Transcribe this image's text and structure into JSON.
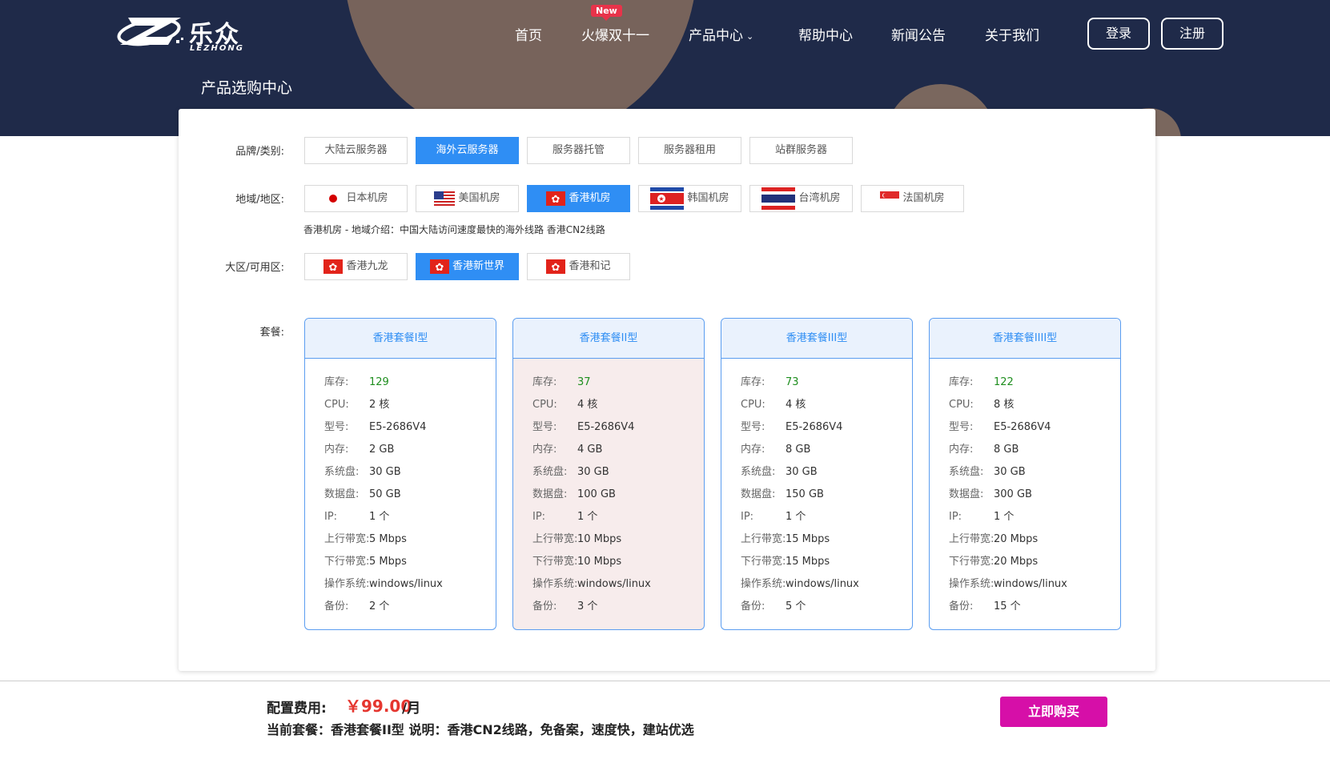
{
  "logo": {
    "cn": "乐众",
    "en": "LEZHONG"
  },
  "nav": {
    "items": [
      "首页",
      "火爆双十一",
      "产品中心",
      "帮助中心",
      "新闻公告",
      "关于我们"
    ],
    "badge": "New",
    "login": "登录",
    "register": "注册"
  },
  "page_title": "产品选购中心",
  "filters": {
    "brand_label": "品牌/类别:",
    "brands": [
      "大陆云服务器",
      "海外云服务器",
      "服务器托管",
      "服务器租用",
      "站群服务器"
    ],
    "brand_selected": "海外云服务器",
    "region_label": "地域/地区:",
    "regions": [
      "日本机房",
      "美国机房",
      "香港机房",
      "韩国机房",
      "台湾机房",
      "法国机房"
    ],
    "region_selected": "香港机房",
    "region_note": "香港机房 - 地域介绍：中国大陆访问速度最快的海外线路 香港CN2线路",
    "zone_label": "大区/可用区:",
    "zones": [
      "香港九龙",
      "香港新世界",
      "香港和记"
    ],
    "zone_selected": "香港新世界"
  },
  "package_label": "套餐:",
  "spec_keys": [
    "库存:",
    "CPU:",
    "型号:",
    "内存:",
    "系统盘:",
    "数据盘:",
    "IP:",
    "上行带宽:",
    "下行带宽:",
    "操作系统:",
    "备份:"
  ],
  "packages": [
    {
      "name": "香港套餐I型",
      "values": [
        "129",
        "2 核",
        "E5-2686V4",
        "2 GB",
        "30 GB",
        "50 GB",
        "1 个",
        "5 Mbps",
        "5 Mbps",
        "windows/linux",
        "2 个"
      ]
    },
    {
      "name": "香港套餐II型",
      "values": [
        "37",
        "4 核",
        "E5-2686V4",
        "4 GB",
        "30 GB",
        "100 GB",
        "1 个",
        "10 Mbps",
        "10 Mbps",
        "windows/linux",
        "3 个"
      ]
    },
    {
      "name": "香港套餐III型",
      "values": [
        "73",
        "4 核",
        "E5-2686V4",
        "8 GB",
        "30 GB",
        "150 GB",
        "1 个",
        "15 Mbps",
        "15 Mbps",
        "windows/linux",
        "5 个"
      ]
    },
    {
      "name": "香港套餐IIII型",
      "values": [
        "122",
        "8 核",
        "E5-2686V4",
        "8 GB",
        "30 GB",
        "300 GB",
        "1 个",
        "20 Mbps",
        "20 Mbps",
        "windows/linux",
        "15 个"
      ]
    }
  ],
  "package_selected": "香港套餐II型",
  "footer": {
    "cost_label": "配置费用:",
    "price": "￥99.00",
    "unit": "/月",
    "current": "当前套餐：香港套餐II型 说明：香港CN2线路，免备案，速度快，建站优选",
    "buy": "立即购买"
  },
  "colors": {
    "header_bg": "#1f2a49",
    "accent": "#2f8ef4",
    "price": "#e5362f",
    "buy": "#d60fa8",
    "stock": "#1e8e1e"
  }
}
